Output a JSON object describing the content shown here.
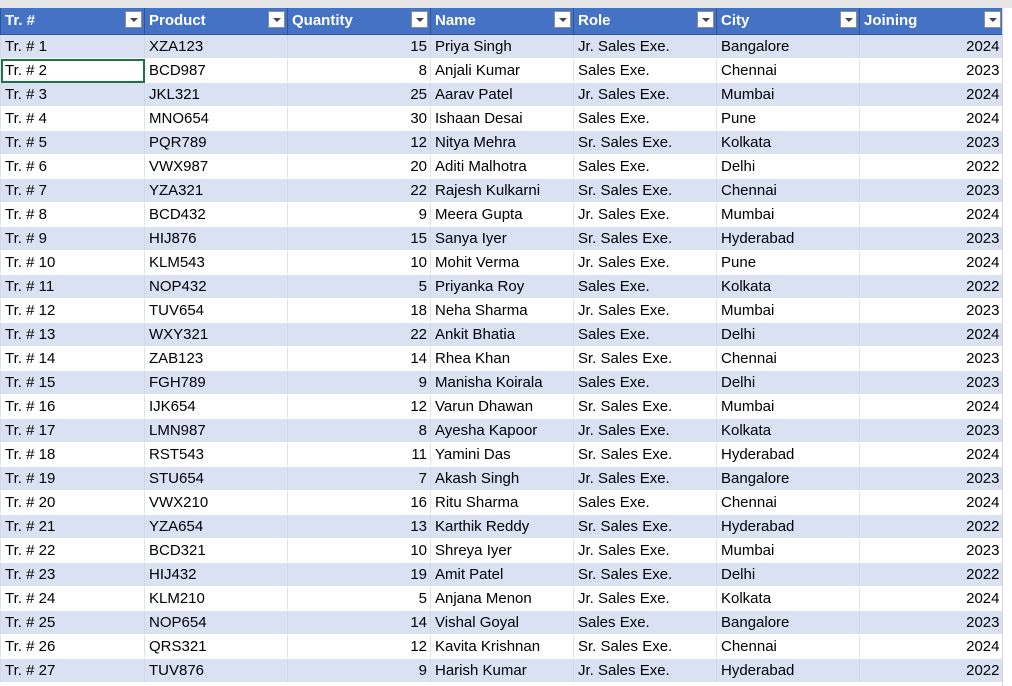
{
  "headers": [
    {
      "label": "Tr. #",
      "key": "tr"
    },
    {
      "label": "Product",
      "key": "product"
    },
    {
      "label": "Quantity",
      "key": "quantity"
    },
    {
      "label": "Name",
      "key": "name"
    },
    {
      "label": "Role",
      "key": "role"
    },
    {
      "label": "City",
      "key": "city"
    },
    {
      "label": "Joining",
      "key": "joining"
    }
  ],
  "rows": [
    [
      "Tr. # 1",
      "XZA123",
      "15",
      "Priya Singh",
      "Jr. Sales Exe.",
      "Bangalore",
      "2024"
    ],
    [
      "Tr. # 2",
      "BCD987",
      "8",
      "Anjali Kumar",
      "Sales Exe.",
      "Chennai",
      "2023"
    ],
    [
      "Tr. # 3",
      "JKL321",
      "25",
      "Aarav Patel",
      "Jr. Sales Exe.",
      "Mumbai",
      "2024"
    ],
    [
      "Tr. # 4",
      "MNO654",
      "30",
      "Ishaan Desai",
      "Sales Exe.",
      "Pune",
      "2024"
    ],
    [
      "Tr. # 5",
      "PQR789",
      "12",
      "Nitya Mehra",
      "Sr. Sales Exe.",
      "Kolkata",
      "2023"
    ],
    [
      "Tr. # 6",
      "VWX987",
      "20",
      "Aditi Malhotra",
      "Sales Exe.",
      "Delhi",
      "2022"
    ],
    [
      "Tr. # 7",
      "YZA321",
      "22",
      "Rajesh Kulkarni",
      "Sr. Sales Exe.",
      "Chennai",
      "2023"
    ],
    [
      "Tr. # 8",
      "BCD432",
      "9",
      "Meera Gupta",
      "Jr. Sales Exe.",
      "Mumbai",
      "2024"
    ],
    [
      "Tr. # 9",
      "HIJ876",
      "15",
      "Sanya Iyer",
      "Sr. Sales Exe.",
      "Hyderabad",
      "2023"
    ],
    [
      "Tr. # 10",
      "KLM543",
      "10",
      "Mohit Verma",
      "Jr. Sales Exe.",
      "Pune",
      "2024"
    ],
    [
      "Tr. # 11",
      "NOP432",
      "5",
      "Priyanka Roy",
      "Sales Exe.",
      "Kolkata",
      "2022"
    ],
    [
      "Tr. # 12",
      "TUV654",
      "18",
      "Neha Sharma",
      "Jr. Sales Exe.",
      "Mumbai",
      "2023"
    ],
    [
      "Tr. # 13",
      "WXY321",
      "22",
      "Ankit Bhatia",
      "Sales Exe.",
      "Delhi",
      "2024"
    ],
    [
      "Tr. # 14",
      "ZAB123",
      "14",
      "Rhea Khan",
      "Sr. Sales Exe.",
      "Chennai",
      "2023"
    ],
    [
      "Tr. # 15",
      "FGH789",
      "9",
      "Manisha Koirala",
      "Sales Exe.",
      "Delhi",
      "2023"
    ],
    [
      "Tr. # 16",
      "IJK654",
      "12",
      "Varun Dhawan",
      "Sr. Sales Exe.",
      "Mumbai",
      "2024"
    ],
    [
      "Tr. # 17",
      "LMN987",
      "8",
      "Ayesha Kapoor",
      "Jr. Sales Exe.",
      "Kolkata",
      "2023"
    ],
    [
      "Tr. # 18",
      "RST543",
      "11",
      "Yamini Das",
      "Sr. Sales Exe.",
      "Hyderabad",
      "2024"
    ],
    [
      "Tr. # 19",
      "STU654",
      "7",
      "Akash Singh",
      "Jr. Sales Exe.",
      "Bangalore",
      "2023"
    ],
    [
      "Tr. # 20",
      "VWX210",
      "16",
      "Ritu Sharma",
      "Sales Exe.",
      "Chennai",
      "2024"
    ],
    [
      "Tr. # 21",
      "YZA654",
      "13",
      "Karthik Reddy",
      "Sr. Sales Exe.",
      "Hyderabad",
      "2022"
    ],
    [
      "Tr. # 22",
      "BCD321",
      "10",
      "Shreya Iyer",
      "Jr. Sales Exe.",
      "Mumbai",
      "2023"
    ],
    [
      "Tr. # 23",
      "HIJ432",
      "19",
      "Amit Patel",
      "Sr. Sales Exe.",
      "Delhi",
      "2022"
    ],
    [
      "Tr. # 24",
      "KLM210",
      "5",
      "Anjana Menon",
      "Jr. Sales Exe.",
      "Kolkata",
      "2024"
    ],
    [
      "Tr. # 25",
      "NOP654",
      "14",
      "Vishal Goyal",
      "Sales Exe.",
      "Bangalore",
      "2023"
    ],
    [
      "Tr. # 26",
      "QRS321",
      "12",
      "Kavita Krishnan",
      "Sr. Sales Exe.",
      "Chennai",
      "2024"
    ],
    [
      "Tr. # 27",
      "TUV876",
      "9",
      "Harish Kumar",
      "Jr. Sales Exe.",
      "Hyderabad",
      "2022"
    ]
  ],
  "numeric_columns": [
    2,
    6
  ],
  "selected_cell": {
    "row": 1,
    "col": 0
  },
  "colors": {
    "header_bg": "#4472c4",
    "band_bg": "#d9e1f2",
    "selection": "#217346"
  },
  "icons": {
    "filter": "filter-dropdown-icon"
  }
}
